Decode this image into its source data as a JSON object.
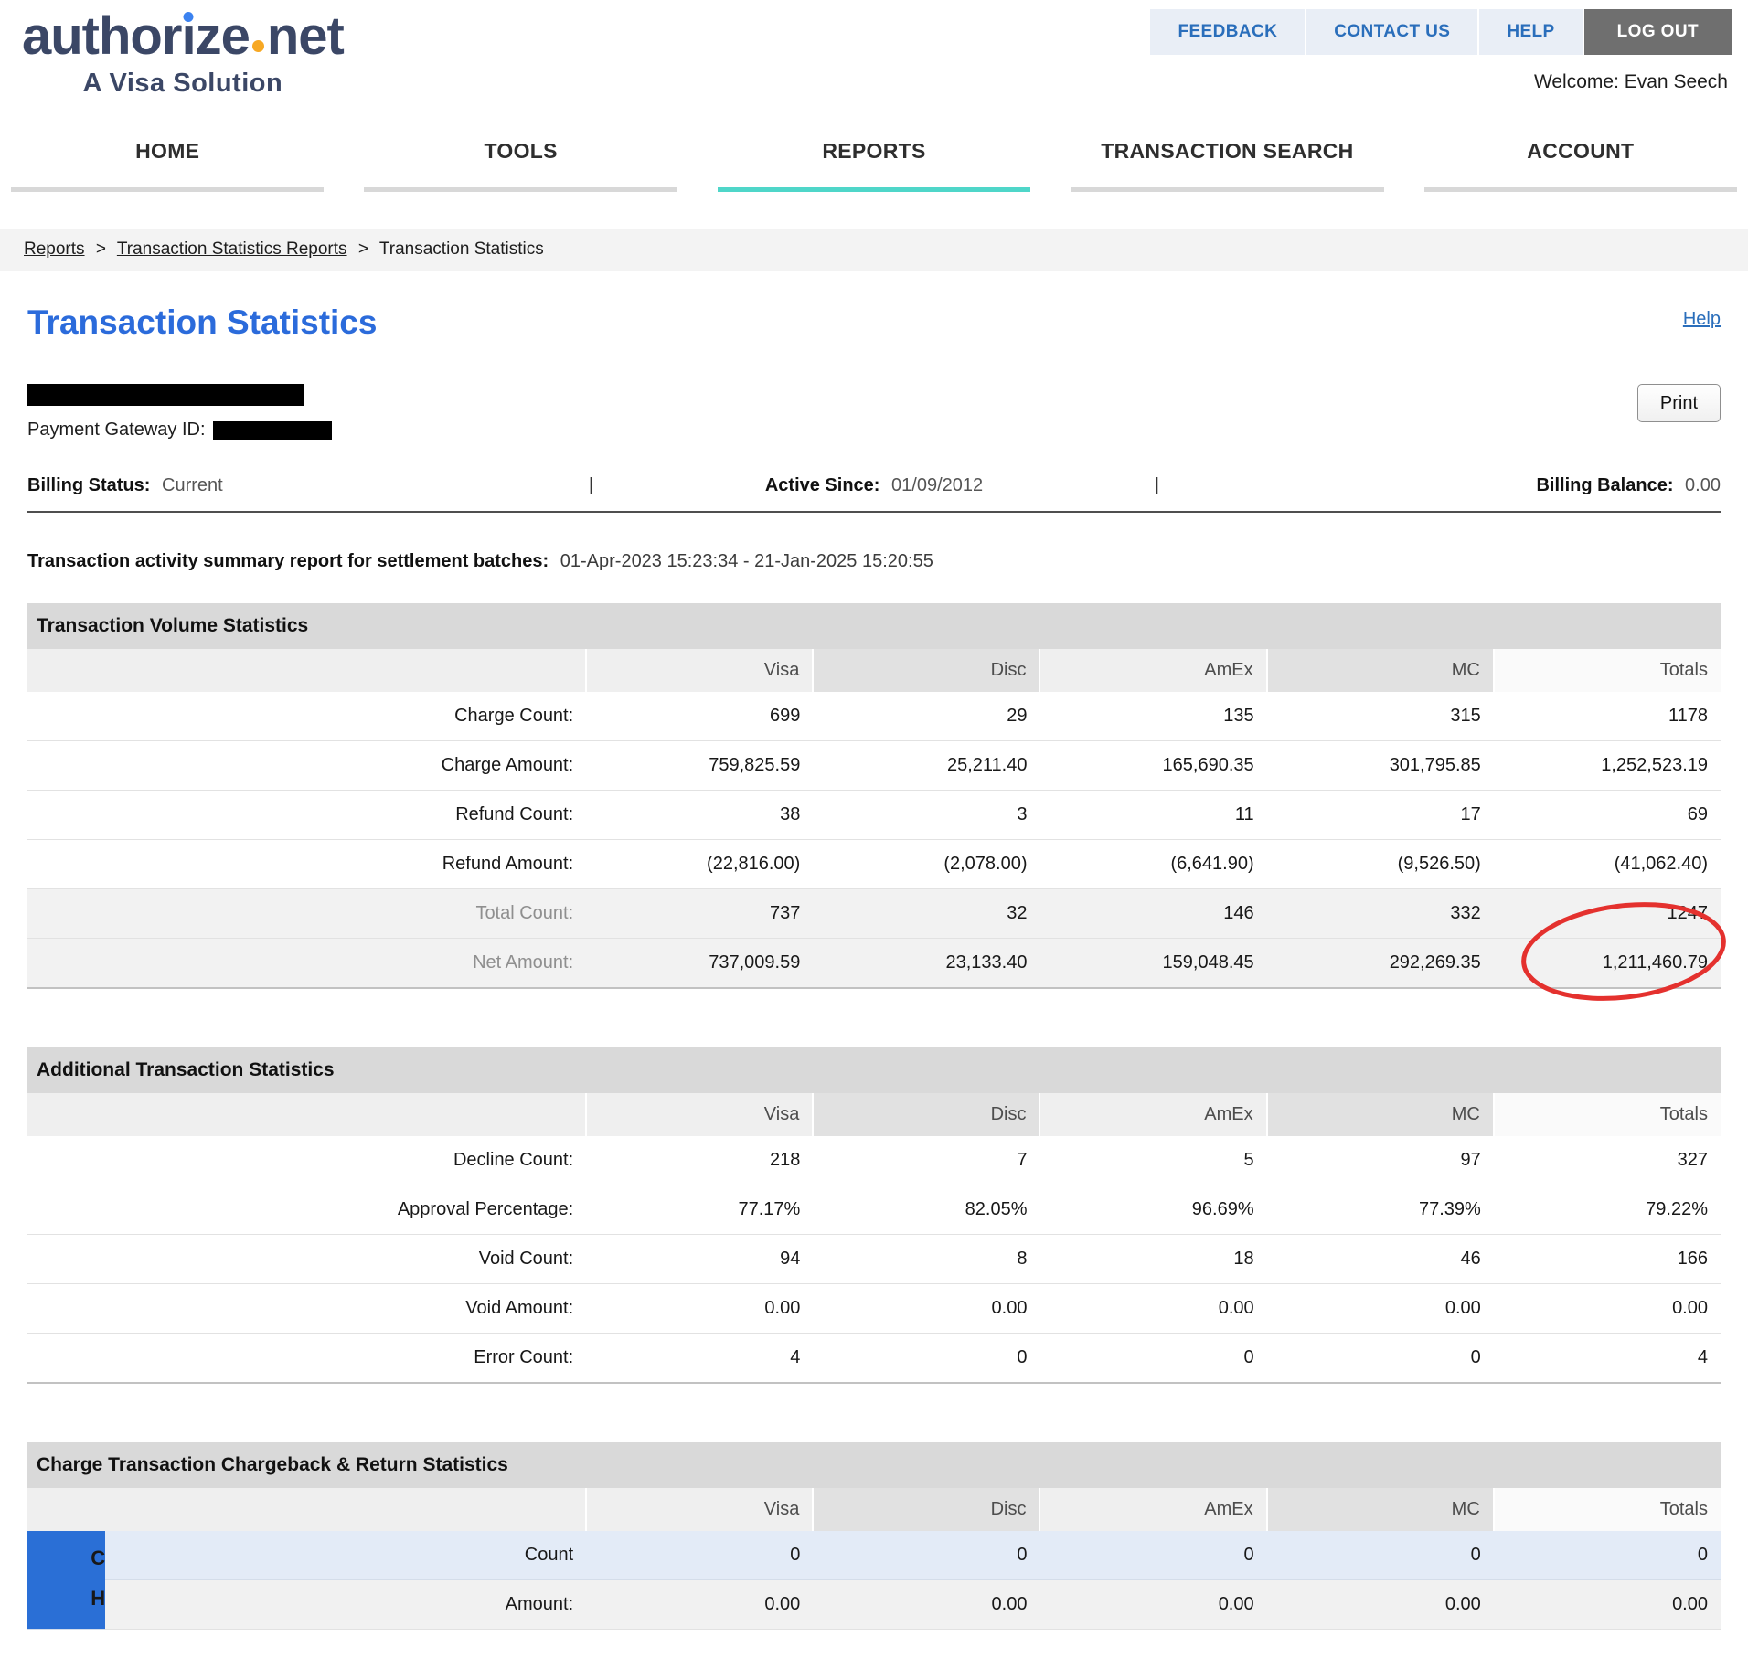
{
  "header": {
    "logo": {
      "pre": "author",
      "i": "ı",
      "post": "ze",
      "net": "net",
      "tagline": "A Visa Solution"
    },
    "links": [
      {
        "label": "FEEDBACK"
      },
      {
        "label": "CONTACT US"
      },
      {
        "label": "HELP"
      },
      {
        "label": "LOG OUT"
      }
    ],
    "welcome": "Welcome: Evan Seech"
  },
  "nav": {
    "items": [
      {
        "label": "HOME",
        "active": false
      },
      {
        "label": "TOOLS",
        "active": false
      },
      {
        "label": "REPORTS",
        "active": true
      },
      {
        "label": "TRANSACTION SEARCH",
        "active": false
      },
      {
        "label": "ACCOUNT",
        "active": false
      }
    ]
  },
  "breadcrumb": {
    "separator": ">",
    "items": [
      {
        "label": "Reports"
      },
      {
        "label": "Transaction Statistics Reports"
      },
      {
        "label": "Transaction Statistics"
      }
    ]
  },
  "page": {
    "title": "Transaction Statistics",
    "help": "Help",
    "print": "Print"
  },
  "merchant": {
    "gateway_label": "Payment Gateway ID:",
    "billing_status_label": "Billing Status:",
    "billing_status_value": "Current",
    "active_since_label": "Active Since:",
    "active_since_value": "01/09/2012",
    "billing_balance_label": "Billing Balance:",
    "billing_balance_value": "0.00",
    "separator": "|"
  },
  "report": {
    "label": "Transaction activity summary report for settlement batches:",
    "range": "01-Apr-2023 15:23:34 - 21-Jan-2025 15:20:55"
  },
  "columns": [
    "Visa",
    "Disc",
    "AmEx",
    "MC",
    "Totals"
  ],
  "volume": {
    "title": "Transaction Volume Statistics",
    "rows": [
      {
        "label": "Charge Count:",
        "values": [
          "699",
          "29",
          "135",
          "315",
          "1178"
        ]
      },
      {
        "label": "Charge Amount:",
        "values": [
          "759,825.59",
          "25,211.40",
          "165,690.35",
          "301,795.85",
          "1,252,523.19"
        ]
      },
      {
        "label": "Refund Count:",
        "values": [
          "38",
          "3",
          "11",
          "17",
          "69"
        ]
      },
      {
        "label": "Refund Amount:",
        "values": [
          "(22,816.00)",
          "(2,078.00)",
          "(6,641.90)",
          "(9,526.50)",
          "(41,062.40)"
        ]
      },
      {
        "label": "Total Count:",
        "values": [
          "737",
          "32",
          "146",
          "332",
          "1247"
        ]
      },
      {
        "label": "Net Amount:",
        "values": [
          "737,009.59",
          "23,133.40",
          "159,048.45",
          "292,269.35",
          "1,211,460.79"
        ]
      }
    ]
  },
  "additional": {
    "title": "Additional Transaction Statistics",
    "rows": [
      {
        "label": "Decline Count:",
        "values": [
          "218",
          "7",
          "5",
          "97",
          "327"
        ]
      },
      {
        "label": "Approval Percentage:",
        "values": [
          "77.17%",
          "82.05%",
          "96.69%",
          "77.39%",
          "79.22%"
        ]
      },
      {
        "label": "Void Count:",
        "values": [
          "94",
          "8",
          "18",
          "46",
          "166"
        ]
      },
      {
        "label": "Void Amount:",
        "values": [
          "0.00",
          "0.00",
          "0.00",
          "0.00",
          "0.00"
        ]
      },
      {
        "label": "Error Count:",
        "values": [
          "4",
          "0",
          "0",
          "0",
          "4"
        ]
      }
    ]
  },
  "chargeback": {
    "title": "Charge Transaction Chargeback & Return Statistics",
    "side_letters": [
      "C",
      "H"
    ],
    "rows": [
      {
        "label": "Count",
        "values": [
          "0",
          "0",
          "0",
          "0",
          "0"
        ]
      },
      {
        "label": "Amount:",
        "values": [
          "0.00",
          "0.00",
          "0.00",
          "0.00",
          "0.00"
        ]
      }
    ]
  },
  "annotation_color": "#e4312e"
}
